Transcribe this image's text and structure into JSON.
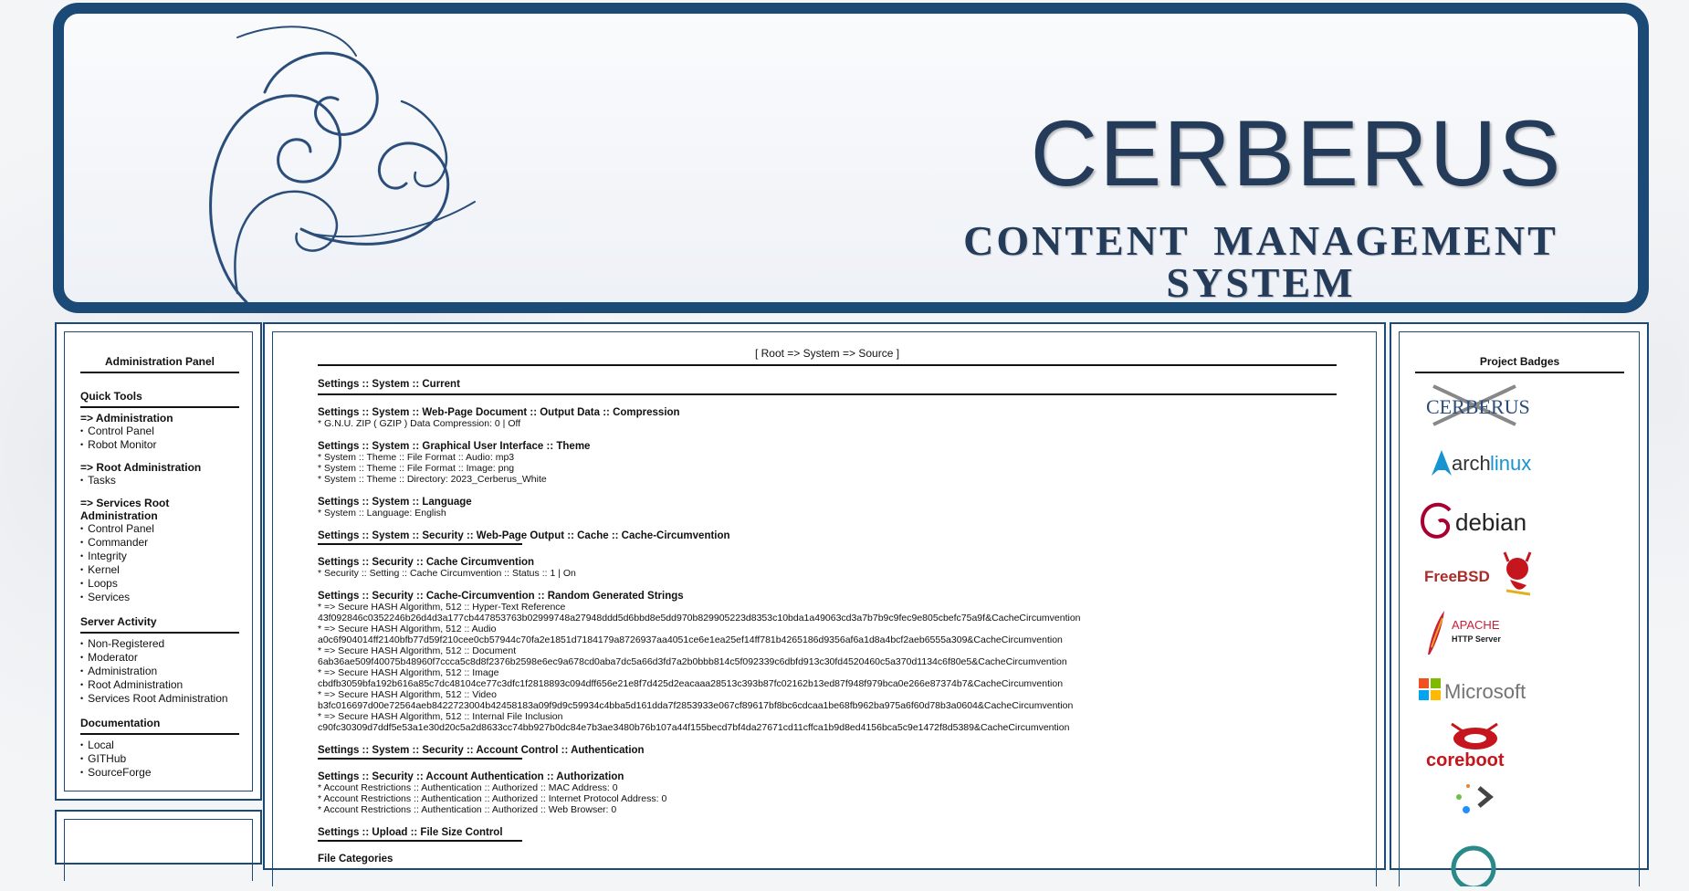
{
  "banner": {
    "title": "CERBERUS",
    "subtitle": "CONTENT MANAGEMENT SYSTEM",
    "brand_color": "#1b4a77"
  },
  "left_panel": {
    "heading": "Administration Panel",
    "quick_tools": {
      "title": "Quick Tools",
      "groups": [
        {
          "title": "=> Administration",
          "items": [
            "Control Panel",
            "Robot Monitor"
          ]
        },
        {
          "title": "=> Root Administration",
          "items": [
            "Tasks"
          ]
        },
        {
          "title": "=> Services Root Administration",
          "items": [
            "Control Panel",
            "Commander",
            "Integrity",
            "Kernel",
            "Loops",
            "Services"
          ]
        }
      ]
    },
    "server_activity": {
      "title": "Server Activity",
      "items": [
        "Non-Registered",
        "Moderator",
        "Administration",
        "Root Administration",
        "Services Root Administration"
      ]
    },
    "documentation": {
      "title": "Documentation",
      "items": [
        "Local",
        "GITHub",
        "SourceForge"
      ]
    }
  },
  "center": {
    "breadcrumb": "[ Root => System => Source ]",
    "current_heading": "Settings :: System :: Current",
    "blocks": [
      {
        "title": "Settings :: System :: Web-Page Document :: Output Data :: Compression",
        "rule": "none",
        "lines": [
          "* G.N.U. ZIP ( GZIP ) Data Compression: 0 | Off"
        ]
      },
      {
        "title": "Settings :: System :: Graphical User Interface :: Theme",
        "rule": "none",
        "lines": [
          "* System :: Theme :: File Format :: Audio: mp3",
          "* System :: Theme :: File Format :: Image: png",
          "* System :: Theme :: Directory: 2023_Cerberus_White"
        ]
      },
      {
        "title": "Settings :: System :: Language",
        "rule": "none",
        "lines": [
          "* System :: Language: English"
        ]
      },
      {
        "title": "Settings :: System :: Security :: Web-Page Output :: Cache :: Cache-Circumvention",
        "rule": "short",
        "lines": []
      },
      {
        "title": "Settings :: Security :: Cache Circumvention",
        "rule": "none",
        "lines": [
          "* Security :: Setting :: Cache Circumvention :: Status :: 1 | On"
        ]
      },
      {
        "title": "Settings :: Security :: Cache-Circumvention :: Random Generated Strings",
        "rule": "none",
        "lines": [
          "* => Secure HASH Algorithm, 512 :: Hyper-Text Reference",
          "43f092846c0352246b26d4d3a177cb447853763b02999748a27948ddd5d6bbd8e5dd970b829905223d8353c10bda1a49063cd3a7b7b9c9fec9e805cbefc75a9f&CacheCircumvention",
          "* => Secure HASH Algorithm, 512 :: Audio",
          "a0c6f904014ff2140bfb77d59f210cee0cb57944c70fa2e1851d7184179a8726937aa4051ce6e1ea25ef14ff781b4265186d9356af6a1d8a4bcf2aeb6555a309&CacheCircumvention",
          "* => Secure HASH Algorithm, 512 :: Document",
          "6ab36ae509f40075b48960f7ccca5c8d8f2376b2598e6ec9a678cd0aba7dc5a66d3fd7a2b0bbb814c5f092339c6dbfd913c30fd4520460c5a370d1134c6f80e5&CacheCircumvention",
          "* => Secure HASH Algorithm, 512 :: Image",
          "cbdfb3059bfa192b616a85c7dc48104ce77c3dfc1f2818893c094dff656e21e8f7d425d2eacaaa28513c393b87fc02162b13ed87f948f979bca0e266e87374b7&CacheCircumvention",
          "* => Secure HASH Algorithm, 512 :: Video",
          "b3fc016697d00e72564aeb8422723004b42458183a09f9d9c59934c4bba5d161dda7f2853933e067cf89617bf8bc6cdcaa1be68fb962ba975a6f60d78b3a0604&CacheCircumvention",
          "* => Secure HASH Algorithm, 512 :: Internal File Inclusion",
          "c90fc30309d7ddf5e53a1e30d20c5a2d8633cc74bb927b0dc84e7b3ae3480b76b107a44f155becd7bf4da27671cd11cffca1b9d8ed4156bca5c9e1472f8d5389&CacheCircumvention"
        ]
      },
      {
        "title": "Settings :: System :: Security :: Account Control :: Authentication",
        "rule": "short",
        "lines": []
      },
      {
        "title": "Settings :: Security :: Account Authentication :: Authorization",
        "rule": "none",
        "lines": [
          "* Account Restrictions :: Authentication :: Authorized :: MAC Address: 0",
          "* Account Restrictions :: Authentication :: Authorized :: Internet Protocol Address: 0",
          "* Account Restrictions :: Authentication :: Authorized :: Web Browser: 0"
        ]
      },
      {
        "title": "Settings :: Upload :: File Size Control",
        "rule": "short",
        "lines": []
      },
      {
        "title": "File Categories",
        "rule": "none",
        "lines": []
      }
    ]
  },
  "right_panel": {
    "heading": "Project Badges",
    "badges": [
      {
        "name": "cerberus-badge",
        "text": "CERBERUS"
      },
      {
        "name": "archlinux-badge",
        "text_a": "arch",
        "text_b": "linux"
      },
      {
        "name": "debian-badge",
        "text": "debian"
      },
      {
        "name": "freebsd-badge",
        "text": "FreeBSD"
      },
      {
        "name": "apache-badge",
        "text_a": "APACHE",
        "text_b": "HTTP Server"
      },
      {
        "name": "microsoft-badge",
        "text": "Microsoft"
      },
      {
        "name": "coreboot-badge",
        "text": "coreboot"
      },
      {
        "name": "shell-badge",
        "text": ""
      },
      {
        "name": "ring-badge",
        "text": ""
      }
    ],
    "colors": {
      "arch": "#1793d1",
      "debian": "#a80030",
      "freebsd": "#ab2b28",
      "apache": "#c92037",
      "coreboot": "#c4161c"
    }
  }
}
